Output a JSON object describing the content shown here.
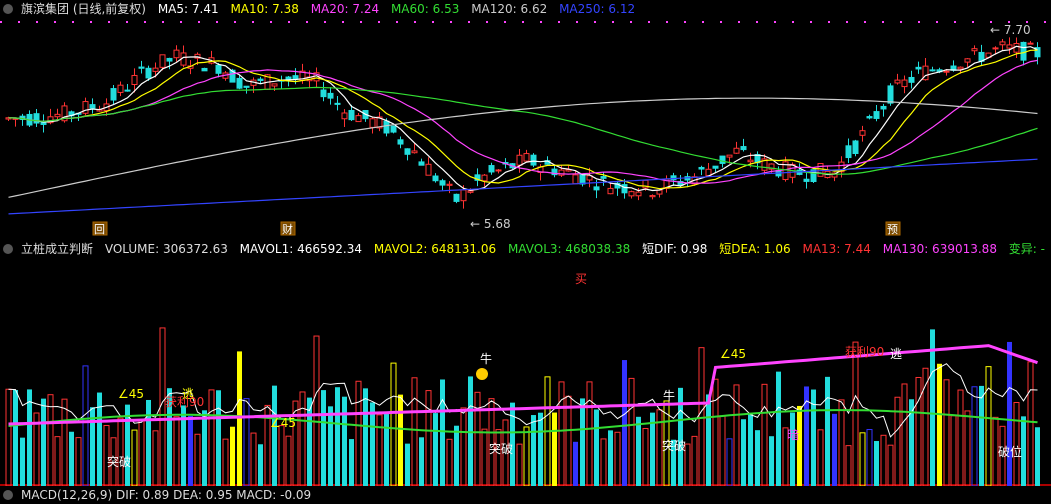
{
  "price_header": {
    "title": "旗滨集团 (日线,前复权)",
    "indicators": [
      {
        "label": "MA5: 7.41",
        "color": "#ffffff"
      },
      {
        "label": "MA10: 7.38",
        "color": "#ffff00"
      },
      {
        "label": "MA20: 7.24",
        "color": "#ff44ff"
      },
      {
        "label": "MA60: 6.53",
        "color": "#33dd33"
      },
      {
        "label": "MA120: 6.62",
        "color": "#cccccc"
      },
      {
        "label": "MA250: 6.12",
        "color": "#3344ff"
      }
    ]
  },
  "price_annotations": {
    "high": "7.70",
    "low": "5.68",
    "markers": [
      "回",
      "财",
      "预"
    ]
  },
  "volume_header": {
    "title": "立桩成立判断",
    "indicators": [
      {
        "label": "VOLUME: 306372.63",
        "color": "#dddddd"
      },
      {
        "label": "MAVOL1: 466592.34",
        "color": "#ffffff"
      },
      {
        "label": "MAVOL2: 648131.06",
        "color": "#ffff00"
      },
      {
        "label": "MAVOL3: 468038.38",
        "color": "#33dd33"
      },
      {
        "label": "短DIF: 0.98",
        "color": "#ffffff"
      },
      {
        "label": "短DEA: 1.06",
        "color": "#ffff00"
      },
      {
        "label": "MA13: 7.44",
        "color": "#ff3333"
      },
      {
        "label": "MA130: 639013.88",
        "color": "#ff44ff"
      },
      {
        "label": "变异: -",
        "color": "#33dd33"
      }
    ]
  },
  "macd_header": {
    "label": "MACD(12,26,9)  DIF: 0.89  DEA: 0.95  MACD: -0.09"
  },
  "volume_annotations": {
    "buy": "买",
    "breakthrough": "突破",
    "escape": "逃",
    "bull": "牛",
    "angle45": "∠45",
    "profit90": "获利90",
    "breakdown": "破位",
    "dark": "暗"
  },
  "colors": {
    "up": "#ff3333",
    "down": "#22dddd",
    "ma5": "#ffffff",
    "ma10": "#ffff00",
    "ma20": "#ff44ff",
    "ma60": "#33dd33",
    "ma120": "#cccccc",
    "ma250": "#3344ff",
    "grid": "#7a1a1a"
  }
}
